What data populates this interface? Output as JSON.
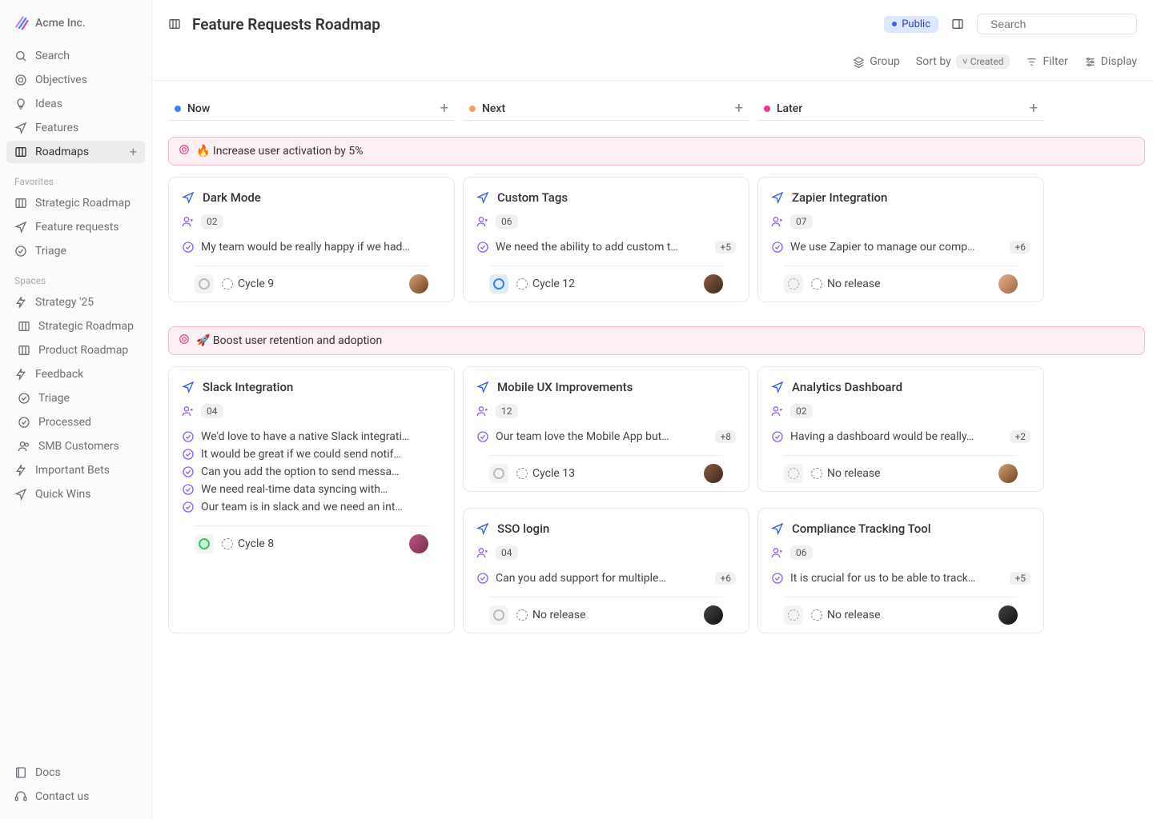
{
  "brand": "Acme Inc.",
  "nav": {
    "search": "Search",
    "objectives": "Objectives",
    "ideas": "Ideas",
    "features": "Features",
    "roadmaps": "Roadmaps"
  },
  "favorites_label": "Favorites",
  "favorites": {
    "strategic": "Strategic Roadmap",
    "requests": "Feature requests",
    "triage": "Triage"
  },
  "spaces_label": "Spaces",
  "spaces": {
    "strategy25": "Strategy '25",
    "strategic_roadmap": "Strategic Roadmap",
    "product_roadmap": "Product Roadmap",
    "feedback": "Feedback",
    "triage": "Triage",
    "processed": "Processed",
    "smb": "SMB Customers",
    "bets": "Important Bets",
    "wins": "Quick Wins"
  },
  "footer": {
    "docs": "Docs",
    "contact": "Contact us"
  },
  "header": {
    "title": "Feature Requests Roadmap",
    "public": "Public",
    "search_placeholder": "Search"
  },
  "toolbar": {
    "group": "Group",
    "sort": "Sort by",
    "sort_value": "Created",
    "filter": "Filter",
    "display": "Display"
  },
  "columns": {
    "now": {
      "name": "Now",
      "color": "#3b82f6"
    },
    "next": {
      "name": "Next",
      "color": "#f0a06b"
    },
    "later": {
      "name": "Later",
      "color": "#e6398e"
    }
  },
  "swimlanes": [
    {
      "label": "🔥 Increase user activation by 5%"
    },
    {
      "label": "🚀 Boost user retention and adoption"
    }
  ],
  "cards": {
    "dark_mode": {
      "title": "Dark Mode",
      "count": "02",
      "reqs": [
        "My team would be really happy if we had…"
      ],
      "cycle": "Cycle 9",
      "status": "gray",
      "avatar": "a1"
    },
    "custom_tags": {
      "title": "Custom Tags",
      "count": "06",
      "reqs": [
        "We need the ability to add custom t…"
      ],
      "more": "+5",
      "cycle": "Cycle 12",
      "status": "blue",
      "avatar": "a2"
    },
    "zapier": {
      "title": "Zapier Integration",
      "count": "07",
      "reqs": [
        "We use Zapier to manage our comp…"
      ],
      "more": "+6",
      "cycle": "No release",
      "status": "dash",
      "avatar": "a3"
    },
    "slack": {
      "title": "Slack Integration",
      "count": "04",
      "reqs": [
        "We'd love to have a native Slack integrati…",
        "It would be great if we could send notif…",
        "Can you add the option to send messa…",
        "We need real-time data syncing with…",
        "Our team is in slack and we need an int…"
      ],
      "cycle": "Cycle 8",
      "status": "green",
      "avatar": "a5"
    },
    "mobile": {
      "title": "Mobile UX Improvements",
      "count": "12",
      "reqs": [
        "Our team love the Mobile App but…"
      ],
      "more": "+8",
      "cycle": "Cycle 13",
      "status": "gray",
      "avatar": "a2"
    },
    "analytics": {
      "title": "Analytics Dashboard",
      "count": "02",
      "reqs": [
        "Having a dashboard would be really…"
      ],
      "more": "+2",
      "cycle": "No release",
      "status": "dash",
      "avatar": "a1"
    },
    "sso": {
      "title": "SSO login",
      "count": "04",
      "reqs": [
        "Can you add support for multiple…"
      ],
      "more": "+6",
      "cycle": "No release",
      "status": "gray",
      "avatar": "a4"
    },
    "compliance": {
      "title": "Compliance Tracking Tool",
      "count": "06",
      "reqs": [
        "It is crucial for us to be able to track…"
      ],
      "more": "+5",
      "cycle": "No release",
      "status": "dash",
      "avatar": "a4"
    }
  }
}
